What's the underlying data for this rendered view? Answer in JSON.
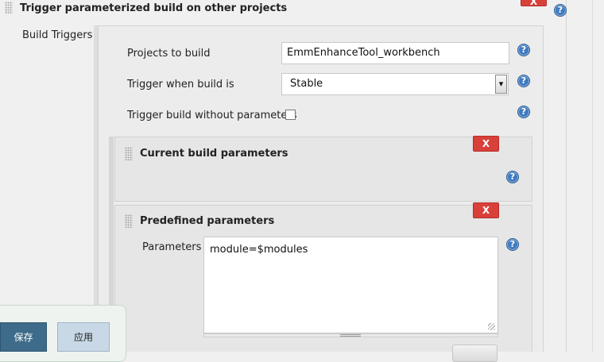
{
  "header": {
    "title": "Trigger parameterized build on other projects",
    "delete_label": "X"
  },
  "side": {
    "build_triggers_label": "Build Triggers"
  },
  "form": {
    "projects_label": "Projects to build",
    "projects_value": "EmmEnhanceTool_workbench",
    "trigger_when_label": "Trigger when build is",
    "trigger_when_value": "Stable",
    "without_params_label": "Trigger build without parameters",
    "without_params_checked": false
  },
  "current_params": {
    "title": "Current build parameters",
    "delete_label": "X"
  },
  "predefined": {
    "title": "Predefined parameters",
    "delete_label": "X",
    "parameters_label": "Parameters",
    "parameters_value": "module=$modules"
  },
  "footer": {
    "save_label": "保存",
    "apply_label": "应用"
  },
  "help_glyph": "?",
  "dropdown_glyph": "▾",
  "colors": {
    "delete_red": "#d9403a",
    "help_blue": "#3f7bbf",
    "save_bg": "#3f6b8a",
    "apply_bg": "#c8d8e6"
  }
}
